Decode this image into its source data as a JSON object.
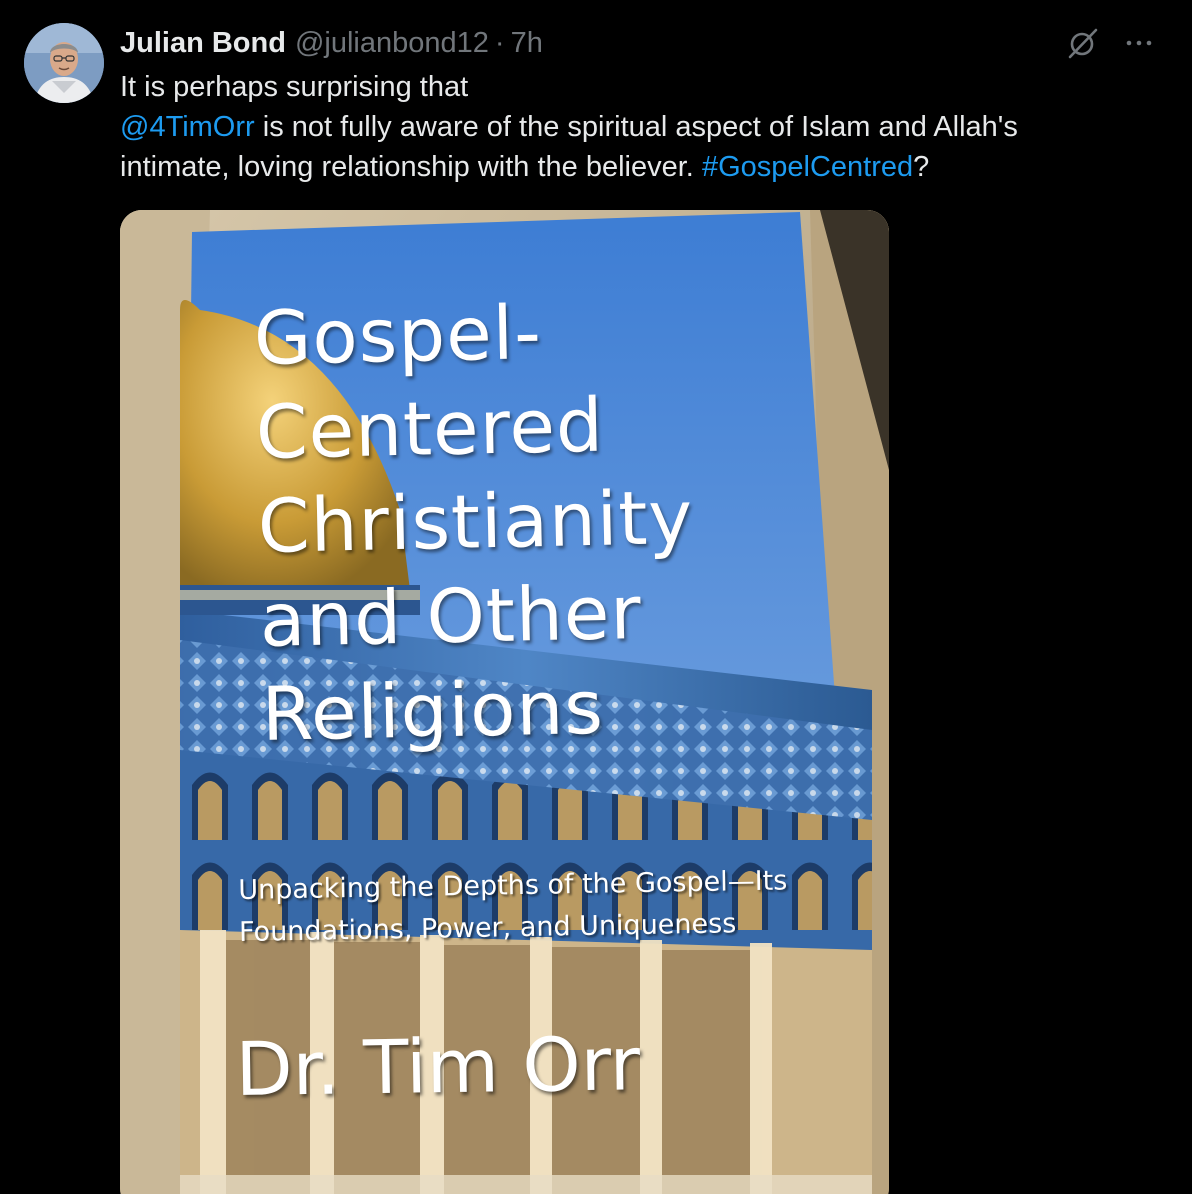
{
  "tweet": {
    "author": {
      "display_name": "Julian Bond",
      "handle": "@julianbond12",
      "avatar_icon": "profile-photo"
    },
    "separator": "·",
    "time": "7h",
    "actions": {
      "grok_icon": "grok-icon",
      "more_icon": "more-icon"
    },
    "text": {
      "line1": "It is perhaps surprising that",
      "mention": "@4TimOrr",
      "line2_rest": " is not fully aware of the spiritual aspect of Islam and Allah's",
      "line3_start": "intimate, loving relationship with the believer. ",
      "hashtag": "#GospelCentred",
      "line3_end": "?"
    },
    "media": {
      "book_cover": {
        "title_lines": [
          "Gospel-",
          "Centered",
          "Christianity",
          "and Other",
          "Religions"
        ],
        "subtitle_lines": [
          "Unpacking the Depths of the Gospel—Its",
          "Foundations, Power, and Uniqueness"
        ],
        "author": "Dr. Tim Orr"
      }
    }
  },
  "colors": {
    "background": "#000000",
    "text": "#e7e9ea",
    "secondary_text": "#71767b",
    "link": "#1d9bf0"
  }
}
